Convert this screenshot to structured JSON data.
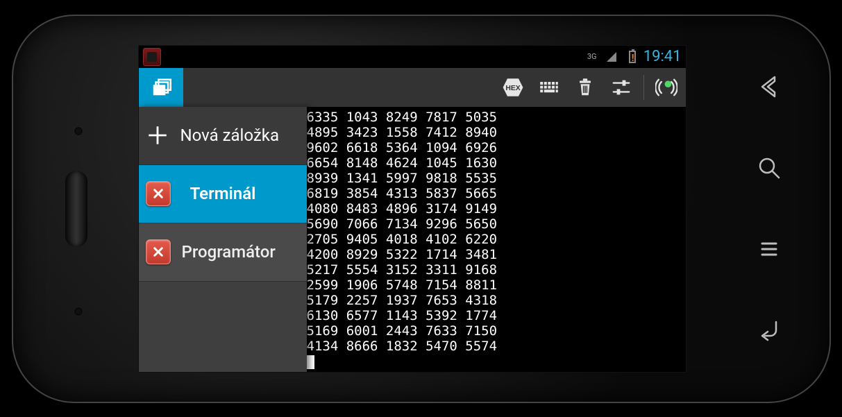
{
  "status": {
    "network": "3G",
    "clock": "19:41"
  },
  "actionbar": {
    "hex_label": "HEX"
  },
  "sidebar": {
    "new_tab_label": "Nová záložka",
    "tabs": [
      {
        "label": "Terminál"
      },
      {
        "label": "Programátor"
      }
    ]
  },
  "terminal_lines": [
    "6335 1043 8249 7817 5035",
    "4895 3423 1558 7412 8940",
    "9602 6618 5364 1094 6926",
    "6654 8148 4624 1045 1630",
    "8939 1341 5997 9818 5535",
    "6819 3854 4313 5837 5665",
    "4080 8483 4896 3174 9149",
    "5690 7066 7134 9296 5650",
    "2705 9405 4018 4102 6220",
    "4200 8929 5322 1714 3481",
    "5217 5554 3152 3311 9168",
    "2599 1906 5748 7154 8811",
    "5179 2257 1937 7653 4318",
    "6130 6577 1143 5392 1774",
    "5169 6001 2443 7633 7150",
    "4134 8666 1832 5470 5574"
  ]
}
